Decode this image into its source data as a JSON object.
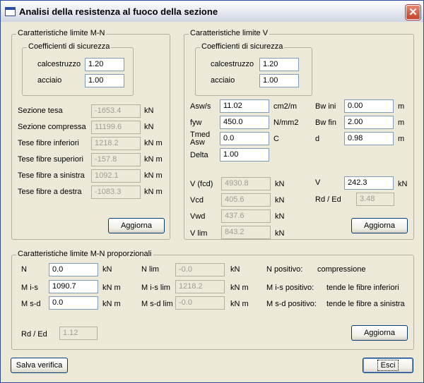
{
  "title": "Analisi della resistenza al fuoco della sezione",
  "close_glyph": "✕",
  "mn": {
    "legend": "Caratteristiche limite M-N",
    "coeff_legend": "Coefficienti di sicurezza",
    "calcestruzzo_label": "calcestruzzo",
    "calcestruzzo_value": "1.20",
    "acciaio_label": "acciaio",
    "acciaio_value": "1.00",
    "rows": [
      {
        "label": "Sezione tesa",
        "value": "-1653.4",
        "unit": "kN"
      },
      {
        "label": "Sezione compressa",
        "value": "11199.6",
        "unit": "kN"
      },
      {
        "label": "Tese fibre inferiori",
        "value": "1218.2",
        "unit": "kN m"
      },
      {
        "label": "Tese fibre superiori",
        "value": "-157.8",
        "unit": "kN m"
      },
      {
        "label": "Tese fibre a sinistra",
        "value": "1092.1",
        "unit": "kN m"
      },
      {
        "label": "Tese fibre a destra",
        "value": "-1083.3",
        "unit": "kN m"
      }
    ],
    "aggiorna": "Aggiorna"
  },
  "v": {
    "legend": "Caratteristiche limite V",
    "coeff_legend": "Coefficienti di sicurezza",
    "calcestruzzo_label": "calcestruzzo",
    "calcestruzzo_value": "1.20",
    "acciaio_label": "acciaio",
    "acciaio_value": "1.00",
    "asw_label": "Asw/s",
    "asw_value": "11.02",
    "asw_unit": "cm2/m",
    "fyw_label": "fyw",
    "fyw_value": "450.0",
    "fyw_unit": "N/mm2",
    "tmed_label_1": "Tmed",
    "tmed_label_2": "Asw",
    "tmed_value": "0.0",
    "tmed_unit": "C",
    "delta_label": "Delta",
    "delta_value": "1.00",
    "bwini_label": "Bw ini",
    "bwini_value": "0.00",
    "bwini_unit": "m",
    "bwfin_label": "Bw fin",
    "bwfin_value": "2.00",
    "bwfin_unit": "m",
    "d_label": "d",
    "d_value": "0.98",
    "d_unit": "m",
    "vfcd_label": "V (fcd)",
    "vfcd_value": "4930.8",
    "vfcd_unit": "kN",
    "vcd_label": "Vcd",
    "vcd_value": "405.6",
    "vcd_unit": "kN",
    "vwd_label": "Vwd",
    "vwd_value": "437.6",
    "vwd_unit": "kN",
    "vlim_label": "V lim",
    "vlim_value": "843.2",
    "vlim_unit": "kN",
    "vv_label": "V",
    "vv_value": "242.3",
    "vv_unit": "kN",
    "rded_label": "Rd / Ed",
    "rded_value": "3.48",
    "aggiorna": "Aggiorna"
  },
  "mnp": {
    "legend": "Caratteristiche limite M-N proporzionali",
    "n_label": "N",
    "n_value": "0.0",
    "n_unit": "kN",
    "mis_label": "M i-s",
    "mis_value": "1090.7",
    "mis_unit": "kN m",
    "msd_label": "M s-d",
    "msd_value": "0.0",
    "msd_unit": "kN m",
    "nlim_label": "N lim",
    "nlim_value": "-0.0",
    "nlim_unit": "kN",
    "mislim_label": "M i-s lim",
    "mislim_value": "1218.2",
    "mislim_unit": "kN m",
    "msdlim_label": "M s-d lim",
    "msdlim_value": "-0.0",
    "msdlim_unit": "kN m",
    "npos_label": "N positivo:",
    "npos_text": "compressione",
    "mispos_label": "M i-s  positivo:",
    "mispos_text": "tende le fibre inferiori",
    "msdpos_label": "M s-d positivo:",
    "msdpos_text": "tende le fibre a sinistra",
    "rded_label": "Rd / Ed",
    "rded_value": "1.12",
    "aggiorna": "Aggiorna"
  },
  "salva": "Salva verifica",
  "esci": "Esci"
}
